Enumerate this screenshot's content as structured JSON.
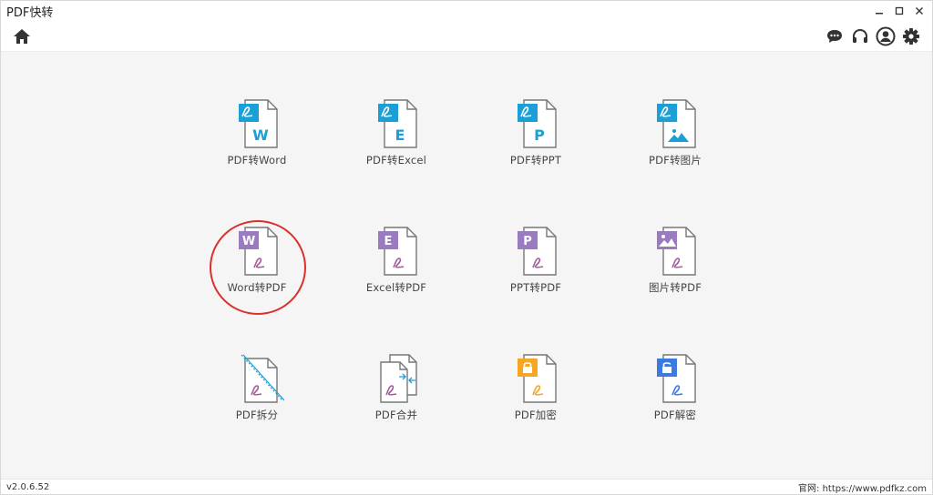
{
  "window": {
    "title": "PDF快转"
  },
  "tools": {
    "row1": [
      {
        "label": "PDF转Word",
        "badge": "W",
        "kind": "from-pdf",
        "color": "#1a9fd6"
      },
      {
        "label": "PDF转Excel",
        "badge": "E",
        "kind": "from-pdf",
        "color": "#1a9fd6"
      },
      {
        "label": "PDF转PPT",
        "badge": "P",
        "kind": "from-pdf",
        "color": "#1a9fd6"
      },
      {
        "label": "PDF转图片",
        "badge": "image",
        "kind": "from-pdf",
        "color": "#1a9fd6"
      }
    ],
    "row2": [
      {
        "label": "Word转PDF",
        "badge": "W",
        "kind": "to-pdf",
        "color": "#9b7bc0"
      },
      {
        "label": "Excel转PDF",
        "badge": "E",
        "kind": "to-pdf",
        "color": "#9b7bc0"
      },
      {
        "label": "PPT转PDF",
        "badge": "P",
        "kind": "to-pdf",
        "color": "#9b7bc0"
      },
      {
        "label": "图片转PDF",
        "badge": "image",
        "kind": "to-pdf",
        "color": "#9b7bc0"
      }
    ],
    "row3": [
      {
        "label": "PDF拆分",
        "kind": "split"
      },
      {
        "label": "PDF合并",
        "kind": "merge"
      },
      {
        "label": "PDF加密",
        "kind": "encrypt",
        "color": "#f5a623"
      },
      {
        "label": "PDF解密",
        "kind": "decrypt",
        "color": "#3b7be0"
      }
    ]
  },
  "status": {
    "version": "v2.0.6.52",
    "website": "官网: https://www.pdfkz.com"
  },
  "colors": {
    "accent_blue": "#1a9fd6",
    "accent_purple": "#9b7bc0",
    "highlight": "#d9302c",
    "pdf_glyph": "#a55a9c"
  },
  "icons": [
    "home-icon",
    "chat-icon",
    "headset-icon",
    "user-icon",
    "gear-icon",
    "minimize-icon",
    "maximize-icon",
    "close-icon"
  ]
}
